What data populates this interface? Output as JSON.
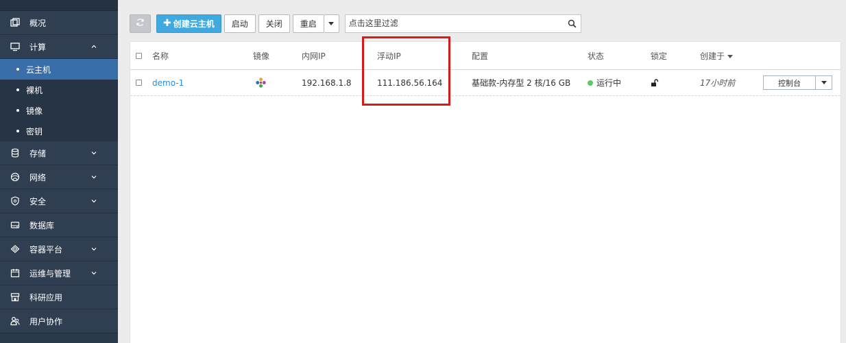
{
  "sidebar": {
    "items": [
      {
        "label": "概况",
        "icon": "overview-icon",
        "expandable": false
      },
      {
        "label": "计算",
        "icon": "monitor-icon",
        "expandable": true,
        "expanded": true,
        "children": [
          {
            "label": "云主机",
            "active": true
          },
          {
            "label": "裸机",
            "active": false
          },
          {
            "label": "镜像",
            "active": false
          },
          {
            "label": "密钥",
            "active": false
          }
        ]
      },
      {
        "label": "存储",
        "icon": "database-icon",
        "expandable": true
      },
      {
        "label": "网络",
        "icon": "network-icon",
        "expandable": true
      },
      {
        "label": "安全",
        "icon": "shield-icon",
        "expandable": true
      },
      {
        "label": "数据库",
        "icon": "db-server-icon",
        "expandable": false
      },
      {
        "label": "容器平台",
        "icon": "container-icon",
        "expandable": true
      },
      {
        "label": "运维与管理",
        "icon": "calendar-icon",
        "expandable": true
      },
      {
        "label": "科研应用",
        "icon": "store-icon",
        "expandable": false
      },
      {
        "label": "用户协作",
        "icon": "users-icon",
        "expandable": false
      }
    ]
  },
  "toolbar": {
    "refresh_icon": "refresh-icon",
    "create_label": "创建云主机",
    "start_label": "启动",
    "stop_label": "关闭",
    "restart_label": "重启",
    "filter_placeholder": "点击这里过滤"
  },
  "table": {
    "columns": [
      "名称",
      "镜像",
      "内网IP",
      "浮动IP",
      "配置",
      "状态",
      "锁定",
      "创建于"
    ],
    "sorted_column": "创建于",
    "rows": [
      {
        "name": "demo-1",
        "image_icon": "os-logo-icon",
        "private_ip": "192.168.1.8",
        "floating_ip": "111.186.56.164",
        "flavor": "基础款-内存型 2 核/16 GB",
        "status": "运行中",
        "status_color": "#5cc86a",
        "lock_icon": "unlock-icon",
        "created": "17小时前",
        "console_label": "控制台"
      }
    ]
  },
  "colors": {
    "sidebar_bg": "#2b3a4b",
    "active_item": "#3a6ea8",
    "primary_button": "#3fa9e0",
    "link": "#2b8cd6",
    "highlight_box": "#d31b1b"
  }
}
